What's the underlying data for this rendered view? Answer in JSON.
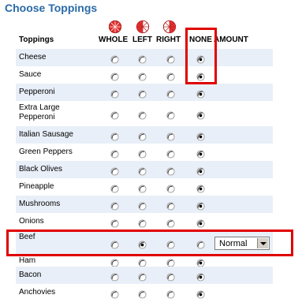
{
  "page": {
    "title": "Choose Toppings"
  },
  "columns": {
    "toppings": "Toppings",
    "whole": "WHOLE",
    "left": "LEFT",
    "right": "RIGHT",
    "none": "NONE",
    "amount": "AMOUNT"
  },
  "rows": [
    {
      "label": "Cheese",
      "selected": "none"
    },
    {
      "label": "Sauce",
      "selected": "none"
    },
    {
      "label": "Pepperoni",
      "selected": "none"
    },
    {
      "label": "Extra Large Pepperoni",
      "selected": "none"
    },
    {
      "label": "Italian Sausage",
      "selected": "none"
    },
    {
      "label": "Green Peppers",
      "selected": "none"
    },
    {
      "label": "Black Olives",
      "selected": "none"
    },
    {
      "label": "Pineapple",
      "selected": "none"
    },
    {
      "label": "Mushrooms",
      "selected": "none"
    },
    {
      "label": "Onions",
      "selected": "none"
    },
    {
      "label": "Beef",
      "selected": "left",
      "amount": "Normal"
    },
    {
      "label": "Ham",
      "selected": "none"
    },
    {
      "label": "Bacon",
      "selected": "none"
    },
    {
      "label": "Anchovies",
      "selected": "none"
    }
  ],
  "colors": {
    "title": "#2a6aa8",
    "highlight": "#e00000",
    "row_shade": "#e9eff8",
    "pizza_icon": "#e03030"
  }
}
